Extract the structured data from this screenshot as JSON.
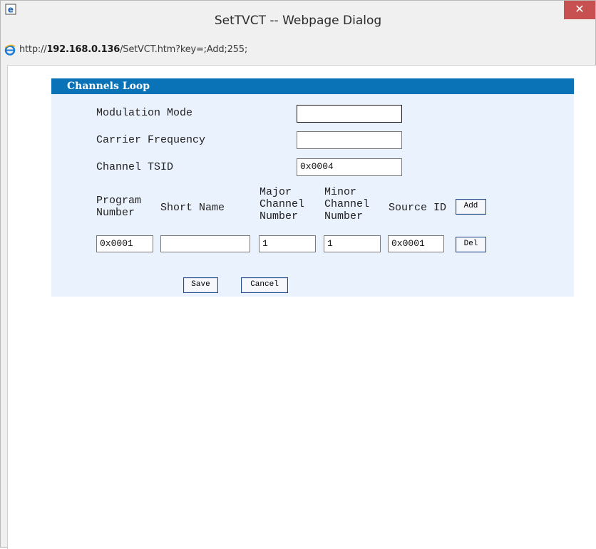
{
  "window": {
    "title": "SetTVCT -- Webpage Dialog",
    "close_label": "✕",
    "address": {
      "prefix": "http://",
      "host": "192.168.0.136",
      "path": "/SetVCT.htm?key=;Add;255;"
    }
  },
  "panel": {
    "header": "Channels Loop",
    "fields": {
      "modulation_mode": {
        "label": "Modulation Mode",
        "value": ""
      },
      "carrier_frequency": {
        "label": "Carrier Frequency",
        "value": ""
      },
      "channel_tsid": {
        "label": "Channel TSID",
        "value": "0x0004"
      }
    },
    "columns": {
      "program_number": [
        "Program",
        "Number"
      ],
      "short_name": "Short Name",
      "major_channel": [
        "Major",
        "Channel",
        "Number"
      ],
      "minor_channel": [
        "Minor",
        "Channel",
        "Number"
      ],
      "source_id": "Source ID"
    },
    "row": {
      "program_number": "0x0001",
      "short_name": "",
      "major_channel": "1",
      "minor_channel": "1",
      "source_id": "0x0001"
    },
    "buttons": {
      "add": "Add",
      "del": "Del",
      "save": "Save",
      "cancel": "Cancel"
    }
  },
  "icons": [
    "ie-logo-icon",
    "close-icon"
  ],
  "colors": {
    "header_bg": "#0a73b8",
    "panel_bg": "#eaf2fe",
    "close_bg": "#c75050"
  }
}
